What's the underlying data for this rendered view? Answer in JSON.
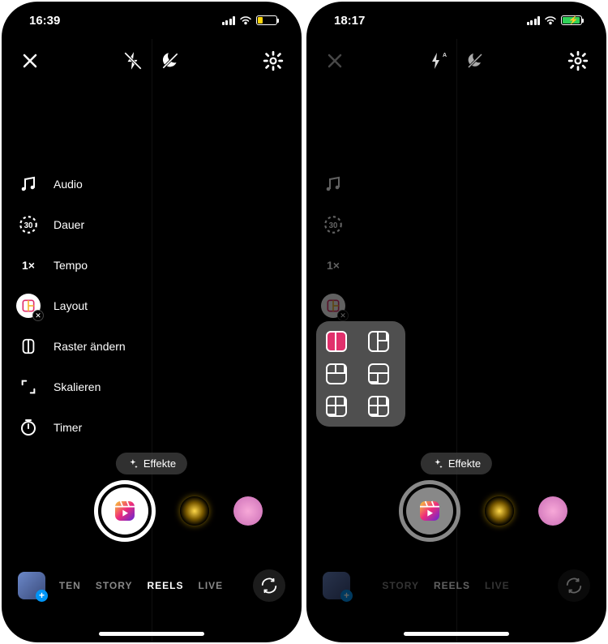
{
  "left": {
    "status": {
      "time": "16:39"
    },
    "tools": {
      "audio": "Audio",
      "duration": "Dauer",
      "duration_val": "30",
      "tempo": "Tempo",
      "tempo_val": "1×",
      "layout": "Layout",
      "raster": "Raster ändern",
      "scale": "Skalieren",
      "timer": "Timer"
    },
    "effects_label": "Effekte",
    "modes": {
      "m1": "TEN",
      "m2": "STORY",
      "m3": "REELS",
      "m4": "LIVE"
    }
  },
  "right": {
    "status": {
      "time": "18:17"
    },
    "duration_val": "30",
    "tempo_val": "1×",
    "effects_label": "Effekte",
    "modes": {
      "m2": "STORY",
      "m3": "REELS",
      "m4": "LIVE"
    }
  }
}
